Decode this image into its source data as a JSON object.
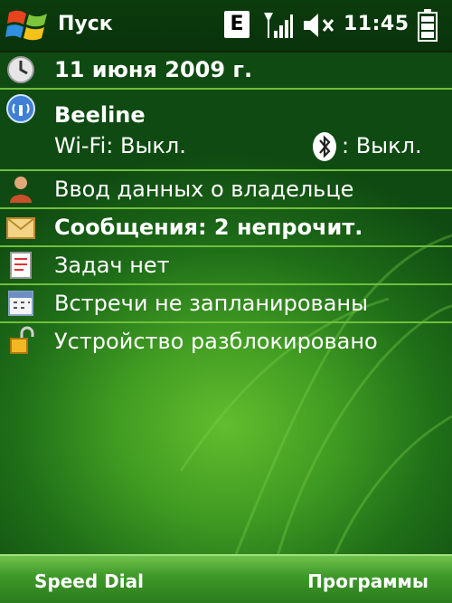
{
  "topbar": {
    "start_label": "Пуск",
    "network_type": "E",
    "time": "11:45"
  },
  "today": {
    "date": "11 июня 2009 г.",
    "operator": "Beeline",
    "wifi_status": "Wi-Fi: Выкл.",
    "bluetooth_status": ": Выкл.",
    "owner_info": "Ввод данных о владельце",
    "messages": "Сообщения: 2 непрочит.",
    "tasks": "Задач нет",
    "appointments": "Встречи не запланированы",
    "device_lock": "Устройство разблокировано"
  },
  "softkeys": {
    "left": "Speed Dial",
    "right": "Программы"
  },
  "colors": {
    "accent_green": "#6fbf3c",
    "background_dark": "#0f4a12"
  }
}
